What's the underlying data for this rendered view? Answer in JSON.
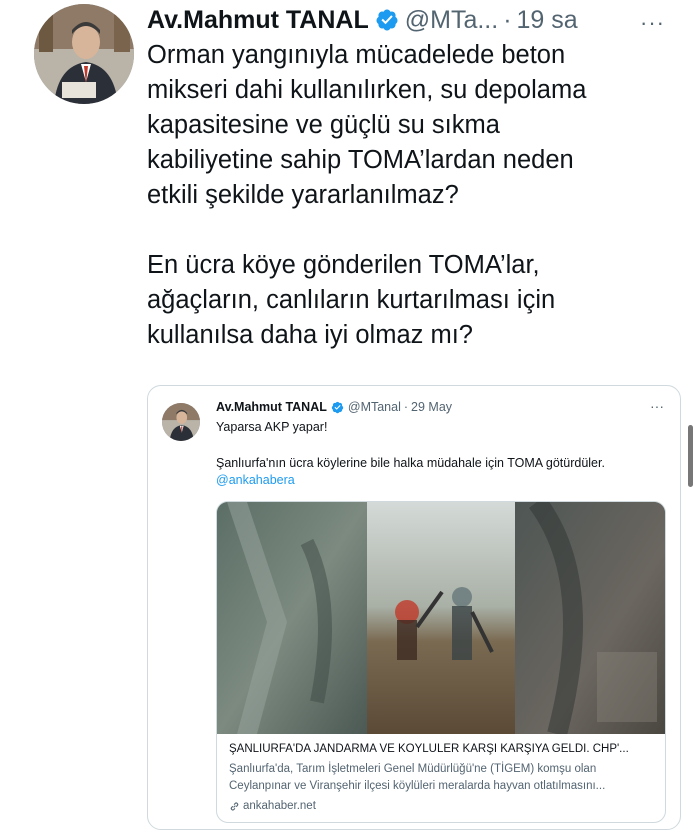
{
  "tweet": {
    "author_name": "Av.Mahmut TANAL",
    "handle": "@MTa...",
    "separator": "·",
    "time": "19 sa",
    "more_icon": "···",
    "text_lines_1": [
      "Orman yangınıyla mücadelede beton",
      "mikseri dahi kullanılırken, su depolama",
      "kapasitesine ve güçlü su sıkma",
      "kabiliyetine sahip TOMA’lardan neden",
      "etkili şekilde yararlanılmaz?"
    ],
    "text_lines_2": [
      "En ücra köye gönderilen TOMA’lar,",
      "ağaçların, canlıların kurtarılması için",
      "kullanılsa daha iyi olmaz mı?"
    ]
  },
  "quote": {
    "author_name": "Av.Mahmut TANAL",
    "handle": "@MTanal",
    "separator": "·",
    "time": "29 May",
    "more_icon": "···",
    "text": "Yaparsa AKP yapar!",
    "line2": "Şanlıurfa'nın ücra köylerine bile halka müdahale için TOMA götürdüler.",
    "link": "@ankahabera",
    "card": {
      "title": "ŞANLIURFA'DA JANDARMA VE KÖYLÜLER KARŞI KARŞIYA GELDİ. CHP'...",
      "description": "Şanlıurfa'da, Tarım İşletmeleri Genel Müdürlüğü'ne (TİGEM) komşu olan Ceylanpınar ve Viranşehir ilçesi köylüleri meralarda hayvan otlatılmasını...",
      "domain": "ankahaber.net"
    }
  },
  "colors": {
    "text": "#0f1419",
    "secondary": "#536471",
    "link": "#1d9bf0",
    "verified": "#1d9bf0",
    "border": "#cfd9de"
  },
  "icons": [
    "verified-badge-icon",
    "more-icon",
    "link-icon"
  ]
}
